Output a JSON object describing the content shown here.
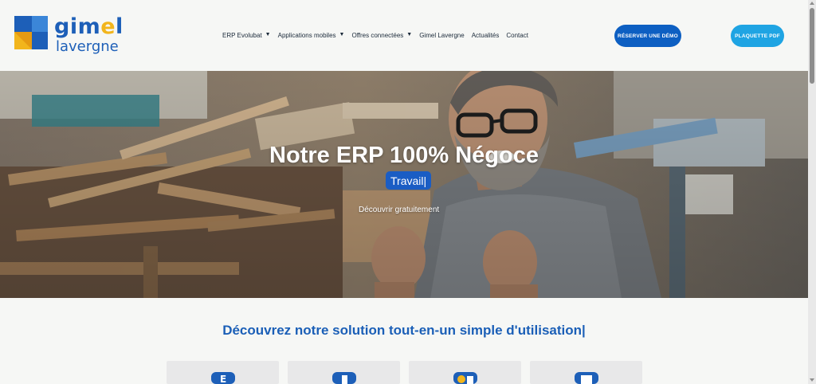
{
  "brand": {
    "name_part1": "gim",
    "name_accent": "e",
    "name_part2": "l",
    "subname": "lavergne",
    "colors": {
      "primary": "#1d5fb8",
      "accent": "#f2b51c"
    }
  },
  "nav": {
    "items": [
      {
        "label": "ERP Evolubat",
        "has_dropdown": true
      },
      {
        "label": "Applications mobiles",
        "has_dropdown": true
      },
      {
        "label": "Offres connectées",
        "has_dropdown": true
      },
      {
        "label": "Gimel Lavergne",
        "has_dropdown": false
      },
      {
        "label": "Actualités",
        "has_dropdown": false
      },
      {
        "label": "Contact",
        "has_dropdown": false
      }
    ],
    "dropdown_icon": "chevron-down-icon"
  },
  "cta": {
    "demo_label": "RÉSERVER UNE DÉMO",
    "pdf_label": "PLAQUETTE PDF"
  },
  "hero": {
    "title": "Notre ERP 100% Négoce",
    "typed_word": "Travail",
    "link_label": "Découvrir gratuitement"
  },
  "section": {
    "title_static": "Découvrez notre solution tout-en-un",
    "title_typed": "simple d'utilisation"
  },
  "cards": [
    {
      "icon": "document-e-icon"
    },
    {
      "icon": "mobile-app-icon"
    },
    {
      "icon": "connected-tools-icon"
    },
    {
      "icon": "tablet-window-icon"
    }
  ]
}
